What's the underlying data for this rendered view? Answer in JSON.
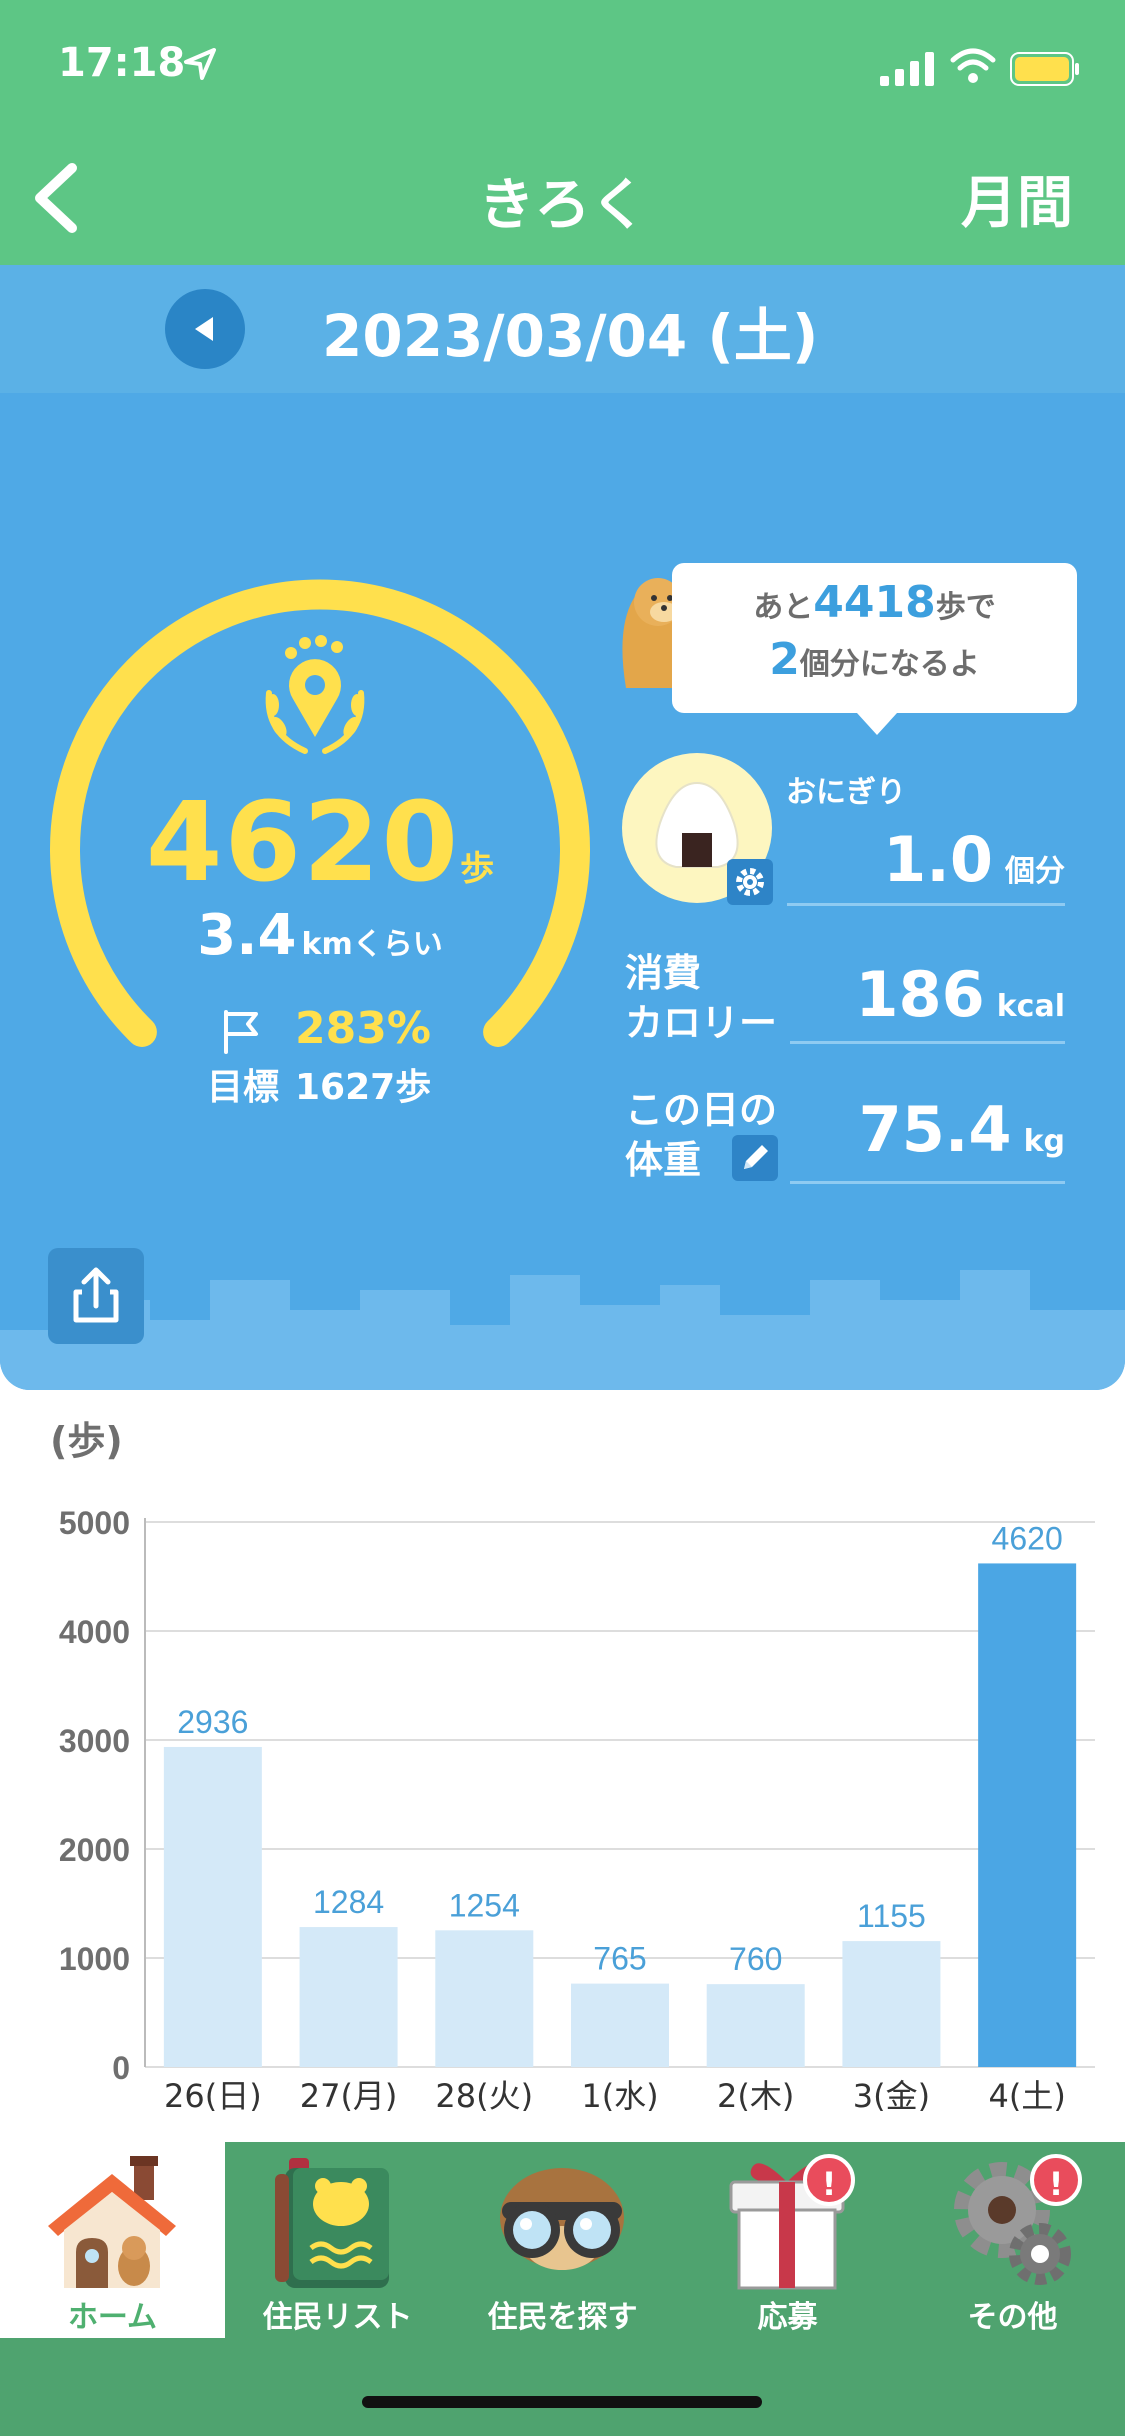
{
  "status_bar": {
    "time": "17:18"
  },
  "header": {
    "title": "きろく",
    "right_label": "月間"
  },
  "date_bar": {
    "date": "2023/03/04 (土)"
  },
  "summary": {
    "steps": "4620",
    "steps_unit": "歩",
    "distance": "3.4",
    "distance_unit": "kmくらい",
    "goal_percent": "283%",
    "goal_label": "目標",
    "goal_steps": "1627歩",
    "goal_progress": 2.83
  },
  "bubble": {
    "prefix": "あと",
    "remaining": "4418",
    "suffix1": "歩で",
    "count": "2",
    "suffix2": "個分になるよ"
  },
  "onigiri": {
    "label": "おにぎり",
    "value": "1.0",
    "unit": "個分"
  },
  "calories": {
    "label_line1": "消費",
    "label_line2": "カロリー",
    "value": "186",
    "unit": "kcal"
  },
  "weight": {
    "label_line1": "この日の",
    "label_line2": "体重",
    "value": "75.4",
    "unit": "kg"
  },
  "chart_data": {
    "type": "bar",
    "ylabel": "(歩)",
    "ylim": [
      0,
      5000
    ],
    "yticks": [
      0,
      1000,
      2000,
      3000,
      4000,
      5000
    ],
    "categories": [
      "26(日)",
      "27(月)",
      "28(火)",
      "1(水)",
      "2(木)",
      "3(金)",
      "4(土)"
    ],
    "values": [
      2936,
      1284,
      1254,
      765,
      760,
      1155,
      4620
    ],
    "highlight_index": 6,
    "bar_color": "#d4e9f8",
    "highlight_color": "#4ba6e4",
    "label_color": "#4aa0d8",
    "grid": true
  },
  "tabs": [
    {
      "label": "ホーム",
      "icon": "house-icon",
      "active": true,
      "badge": ""
    },
    {
      "label": "住民リスト",
      "icon": "book-icon",
      "active": false,
      "badge": ""
    },
    {
      "label": "住民を探す",
      "icon": "binoculars-icon",
      "active": false,
      "badge": ""
    },
    {
      "label": "応募",
      "icon": "gift-icon",
      "active": false,
      "badge": "!"
    },
    {
      "label": "その他",
      "icon": "gear-icon",
      "active": false,
      "badge": "!"
    }
  ],
  "colors": {
    "header_green": "#5dc685",
    "panel_blue": "#4fa9e6",
    "gauge_yellow": "#ffe04d",
    "tabbar_green": "#4fa36f"
  }
}
